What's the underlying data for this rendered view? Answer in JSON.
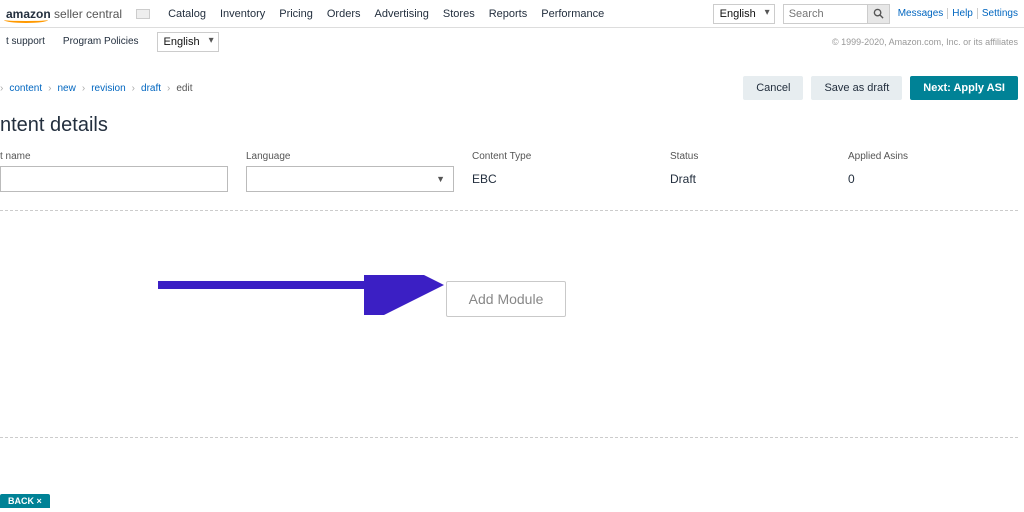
{
  "brand": {
    "part1": "amazon",
    "part2": " seller central"
  },
  "nav": {
    "items": [
      "Catalog",
      "Inventory",
      "Pricing",
      "Orders",
      "Advertising",
      "Stores",
      "Reports",
      "Performance"
    ]
  },
  "lang": {
    "top": "English",
    "sub": "English"
  },
  "search": {
    "placeholder": "Search"
  },
  "toplinks": [
    "Messages",
    "Help",
    "Settings"
  ],
  "subnav": {
    "items": [
      "t support",
      "Program Policies"
    ],
    "copyright": "© 1999-2020, Amazon.com, Inc. or its affiliates"
  },
  "breadcrumb": {
    "chevron": "›",
    "items": [
      "content",
      "new",
      "revision",
      "draft",
      "edit"
    ]
  },
  "actions": {
    "cancel": "Cancel",
    "save_draft": "Save as draft",
    "next_apply": "Next: Apply ASI"
  },
  "title": "ntent details",
  "fields": {
    "name_label": "t name",
    "language_label": "Language",
    "content_type_label": "Content Type",
    "content_type_value": "EBC",
    "status_label": "Status",
    "status_value": "Draft",
    "applied_asins_label": "Applied Asins",
    "applied_asins_value": "0"
  },
  "add_module": "Add Module",
  "back": "BACK ×"
}
